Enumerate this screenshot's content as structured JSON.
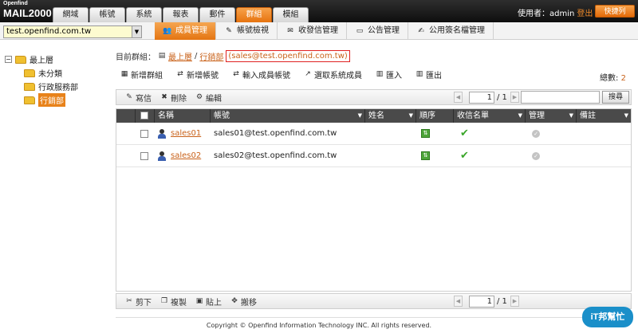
{
  "app": {
    "logo_small": "Openfind",
    "logo_big": "MAIL2000"
  },
  "tabs": [
    {
      "label": "網域"
    },
    {
      "label": "帳號"
    },
    {
      "label": "系統"
    },
    {
      "label": "報表"
    },
    {
      "label": "郵件"
    },
    {
      "label": "群組",
      "active": true
    },
    {
      "label": "模組"
    }
  ],
  "user": {
    "prefix": "使用者：admin",
    "logout": "登出",
    "quick": "快捷列"
  },
  "domain": {
    "value": "test.openfind.com.tw"
  },
  "subtabs": [
    {
      "label": "成員管理",
      "icon": "member-icon",
      "active": true
    },
    {
      "label": "帳號檢視",
      "icon": "account-view-icon"
    },
    {
      "label": "收發信管理",
      "icon": "mail-manage-icon"
    },
    {
      "label": "公告管理",
      "icon": "announce-icon"
    },
    {
      "label": "公用簽名檔管理",
      "icon": "signature-icon"
    }
  ],
  "tree": {
    "root": "最上層",
    "children": [
      {
        "label": "未分類"
      },
      {
        "label": "行政服務部"
      },
      {
        "label": "行銷部",
        "selected": true
      }
    ]
  },
  "breadcrumb": {
    "prefix": "目前群組：",
    "root": "最上層",
    "sep": "/",
    "current": "行銷部",
    "address": "(sales@test.openfind.com.tw)"
  },
  "actions": [
    {
      "label": "新增群組",
      "icon": "add-group-icon"
    },
    {
      "label": "新增帳號",
      "icon": "add-account-icon"
    },
    {
      "label": "輸入成員帳號",
      "icon": "input-member-icon"
    },
    {
      "label": "選取系統成員",
      "icon": "select-member-icon"
    },
    {
      "label": "匯入",
      "icon": "import-icon"
    },
    {
      "label": "匯出",
      "icon": "export-icon"
    }
  ],
  "total": {
    "label": "總數:",
    "value": "2"
  },
  "toolbar": {
    "write": "寫信",
    "delete": "刪除",
    "edit": "編輯",
    "search": "搜尋"
  },
  "pager": {
    "page": "1",
    "total": "/ 1"
  },
  "columns": {
    "name": "名稱",
    "account": "帳號",
    "fullname": "姓名",
    "order": "順序",
    "recipient": "收信名單",
    "manage": "管理",
    "note": "備註"
  },
  "rows": [
    {
      "name": "sales01",
      "account": "sales01@test.openfind.com.tw"
    },
    {
      "name": "sales02",
      "account": "sales02@test.openfind.com.tw"
    }
  ],
  "bottom_toolbar": {
    "cut": "剪下",
    "copy": "複製",
    "paste": "貼上",
    "move": "搬移"
  },
  "bottom_pager": {
    "page": "1",
    "total": "/ 1"
  },
  "footer": "Copyright © Openfind Information Technology INC. All rights reserved.",
  "watermark": "iT邦幫忙"
}
